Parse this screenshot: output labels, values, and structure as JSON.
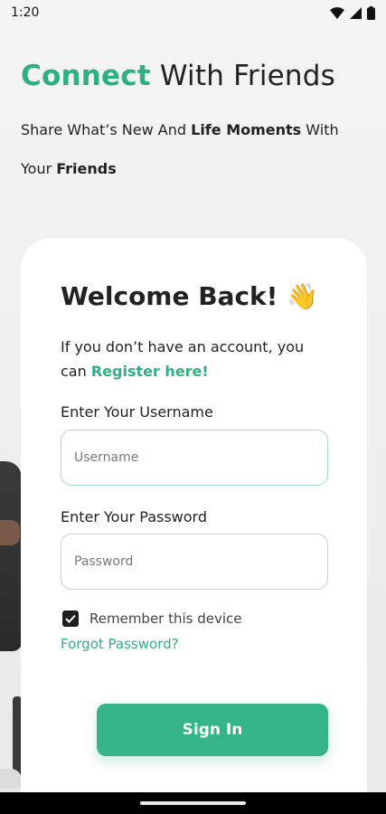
{
  "status_bar": {
    "time": "1:20"
  },
  "hero": {
    "title_accent": "Connect",
    "title_rest": " With Friends",
    "subtitle_part1": "Share What’s New And ",
    "subtitle_bold1": "Life Moments",
    "subtitle_part2": " With Your ",
    "subtitle_bold2": "Friends"
  },
  "card": {
    "welcome": "Welcome Back! ",
    "welcome_emoji": "👋",
    "register_prefix": "If you don’t have an account, you can ",
    "register_link": "Register here!",
    "username_label": "Enter Your Username",
    "username_placeholder": "Username",
    "password_label": "Enter Your Password",
    "password_placeholder": "Password",
    "remember_label": "Remember this device",
    "forgot_label": "Forgot Password?",
    "signin_label": "Sign In"
  },
  "colors": {
    "accent": "#2fb083",
    "button": "#35b488"
  }
}
